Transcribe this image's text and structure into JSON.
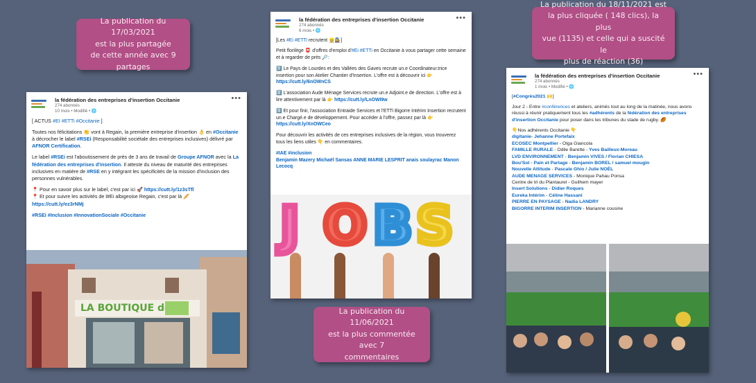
{
  "callouts": {
    "c1": "La publication du 17/03/2021\nest la plus partagée\nde cette année avec 9\npartages",
    "c2": "La publication du 18/11/2021 est\nla plus cliquée ( 148 clics), la plus\nvue (1135)  et celle qui a suscité le\nplus de réaction (36)",
    "c3": "La publication du 11/06/2021\nest la plus commentée avec 7\ncommentaires"
  },
  "post1": {
    "org": "la fédération des entreprises d'insertion Occitanie",
    "followers": "274 abonnés",
    "time": "10 mois • Modifié • 🌐",
    "more": "•••",
    "line1": "[ ACTUS ",
    "line1_tags": "#EI #ETTi #Occitanie",
    "line1_end": " ]",
    "para1a": "Toutes nos félicitations 👏 vont à Regain, la première entreprise d'insertion 👌 en ",
    "para1_tag1": "#Occitanie",
    "para1b": " à décrocher le label ",
    "para1_tag2": "#RSEi",
    "para1c": " (Responsabilité sociétale des entreprises inclusives) délivré par ",
    "para1_link": "AFNOR Certification",
    "para1d": ".",
    "para2a": "Le label ",
    "para2_tag1": "#RSEi",
    "para2b": " est l'aboutissement de près de 3 ans de travail de ",
    "para2_link1": "Groupe AFNOR",
    "para2c": " avec la ",
    "para2_link2": "La fédération des entreprises d'insertion",
    "para2d": ". Il atteste du niveau de maturité des entreprises inclusives en matière de ",
    "para2_tag2": "#RSE",
    "para2e": " en y intégrant les spécificités de la mission d'inclusion des personnes vulnérables.",
    "para3a": "📍 Pour en savoir plus sur le label, c'est par ici 🚀 ",
    "para3_link1": "https://cutt.ly/1z3sTfl",
    "para3b": "📍 Et pour suivre les activités de l#Ei albigeoise Regain, c'est par là 🥖",
    "para3_link2": "https://cutt.ly/ez3rNMj",
    "hashtags": "#RSEi #Inclusion #InnovationSociale #Occitanie",
    "shop_sign": "LA BOUTIQUE de"
  },
  "post2": {
    "org": "la fédération des entreprises d'insertion Occitanie",
    "followers": "274 abonnés",
    "time": "6 mois • 🌐",
    "more": "•••",
    "line1a": "[Les ",
    "line1_tags": "#Ei #ETTi",
    "line1b": " recrutent 👷👩‍🔧]",
    "para1a": "Petit florilège 📮 d'offres d'emploi d'",
    "para1_tags": "#Ei #ETTi",
    "para1b": " en Occitanie à vous partager cette semaine et à regarder de près 🔎:",
    "item1a": "1️⃣ Le Pays de Lourdes et des Vallées des Gaves recrute un.e Coordinateur.trice insertion pour son Atelier Chantier d'Insertion. L'offre est à découvrir ici 👉 ",
    "item1_link": "https://cutt.ly/6nOWnCS",
    "item2a": "2️⃣ L'association Aude Ménage Services recrute un.e Adjoint.e de direction. L'offre est à lire attentivement par là 👉 ",
    "item2_link": "https://cutt.ly/LnOWI9w",
    "item3a": "3️⃣ Et pour finir, l'association Entraide Services et l'ETTi Bigorre Intérim Insertion recrutent un.e Chargé.e de développement. Pour accéder à l'offre, passez par là 👉 ",
    "item3_link": "https://cutt.ly/XnOWCeo",
    "para2": "Pour découvrir les activités de ces entreprises inclusives de la région, vous trouverez tous les liens utiles 👇 en commentaires.",
    "tags": "#IAE #inclusion",
    "people": "Benjamin Mazery Michaël Sansas ANNE MARIE LESPRIT anais soulayrac Manon Lecocq",
    "letters": [
      "J",
      "O",
      "B",
      "S"
    ]
  },
  "post3": {
    "org": "la fédération des entreprises d'insertion Occitanie",
    "followers": "274 abonnés",
    "time": "1 mois • Modifié • 🌐",
    "more": "•••",
    "line1a": "[",
    "line1_tag": "#Congrès2021",
    "line1b": " 🙌]",
    "para1a": "Jour 2 - Entre ",
    "para1_tag1": "#conférences",
    "para1b": " et ateliers, animés tout au long de la matinée, nous avons réussi à réunir pratiquement tous les ",
    "para1_tag2": "#adhérents",
    "para1c": " de la ",
    "para1_link": "fédération des entreprises d'insertion Occitanie",
    "para1d": " pour poser dans les tribunes du stade de rugby. 🏉",
    "adherents_title": "👇Nos adhérents Occitanie 👇",
    "members": [
      {
        "org": "digitanie",
        "sep": "- ",
        "person": "Jehanne Portefaix",
        "person_link": true
      },
      {
        "org": "ECOSEC Montpellier",
        "sep": " - ",
        "person": "Olga Giancola",
        "person_link": false
      },
      {
        "org": "FAMILLE RURALE",
        "sep": " - ",
        "person": "Odile Barette - ",
        "person2": "Yves Bailleux-Moreau",
        "person_link": false
      },
      {
        "org": "LVD ENVIRONNEMENT",
        "sep": " - ",
        "person": "Benjamin VIVES / Florian CHIESA",
        "person_link": true
      },
      {
        "org": "Bou'Sol - Pain et Partage",
        "sep": " - ",
        "person": "Benjamin BOREL / samuel mougin",
        "person_link": true
      },
      {
        "org": "Nouvelle Attitude",
        "sep": " - ",
        "person": "Pascale Ghio / Julie NOËL",
        "person_link": true
      },
      {
        "org": "AUDE MENAGE SERVICES",
        "sep": " - ",
        "person": "Monique Pahau Ponsa",
        "person_link": false
      },
      {
        "org": "",
        "sep": "",
        "person": "Centre de tri du Plantaurel - Guilhem mayer",
        "person_link": false
      },
      {
        "org": "Insert Solutions",
        "sep": " - ",
        "person": "Didier Roques",
        "person_link": true
      },
      {
        "org": "Eureka Intérim",
        "sep": " - ",
        "person": "Céline Hassani",
        "person_link": true
      },
      {
        "org": "PIERRE EN PAYSAGE",
        "sep": " - ",
        "person": "Nadia LANDRY",
        "person_link": true
      },
      {
        "org": "BIGORRE INTERIM INSERTION",
        "sep": " - ",
        "person": "Marianne cousine",
        "person_link": false
      }
    ]
  },
  "colors": {
    "background": "#56627a",
    "callout": "#b14f86",
    "link": "#0a66c2"
  }
}
